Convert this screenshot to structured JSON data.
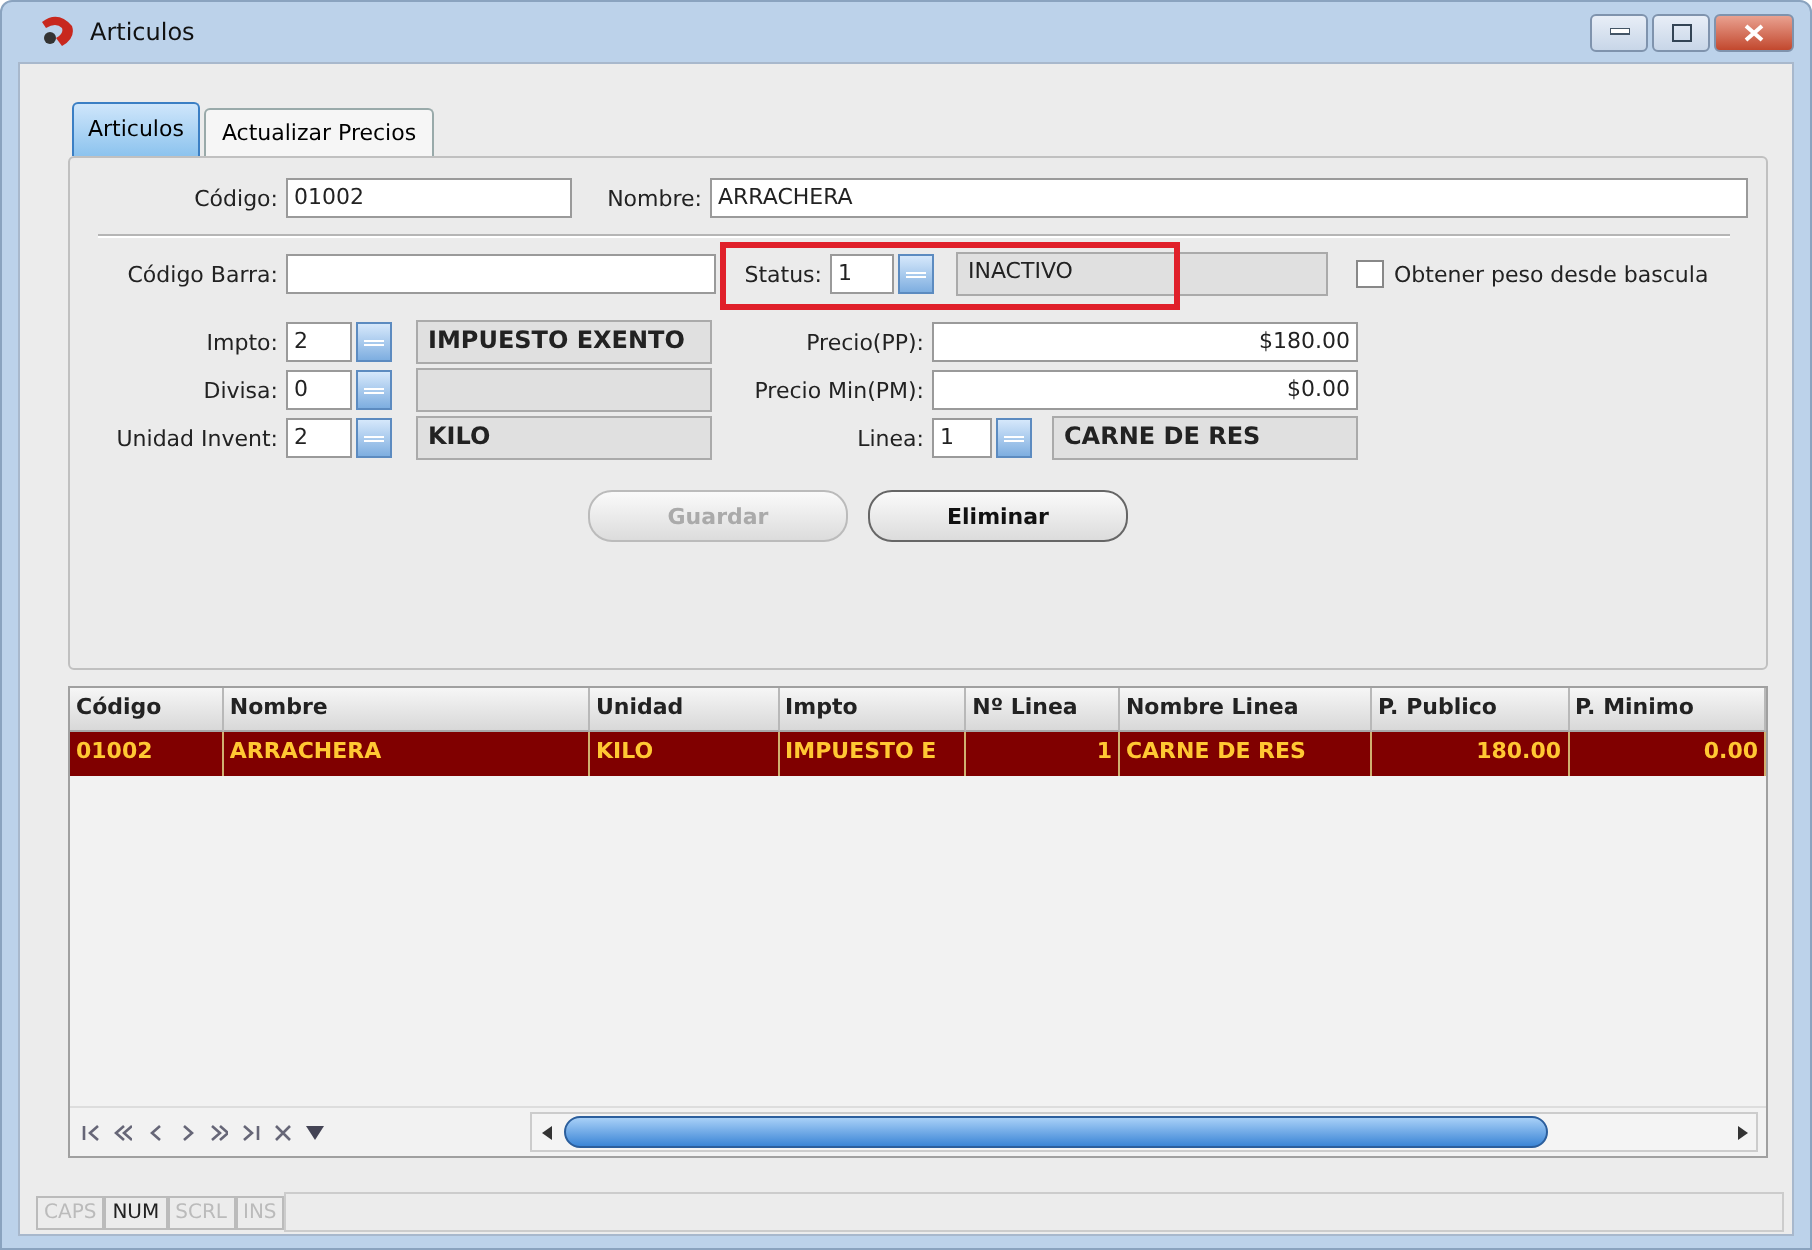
{
  "window": {
    "title": "Articulos"
  },
  "tabs": [
    {
      "label": "Articulos",
      "selected": true
    },
    {
      "label": "Actualizar Precios",
      "selected": false
    }
  ],
  "form": {
    "codigo": {
      "label": "Código:",
      "value": "01002"
    },
    "nombre": {
      "label": "Nombre:",
      "value": "ARRACHERA"
    },
    "codigo_barra": {
      "label": "Código Barra:"
    },
    "status": {
      "label": "Status:",
      "value": "1",
      "description": "INACTIVO",
      "highlighted": true
    },
    "obtener_peso": {
      "label": "Obtener peso desde bascula",
      "checked": false
    },
    "impto": {
      "label": "Impto:",
      "value": "2",
      "description": "IMPUESTO EXENTO"
    },
    "divisa": {
      "label": "Divisa:",
      "value": "0"
    },
    "unidad_invent": {
      "label": "Unidad Invent:",
      "value": "2",
      "description": "KILO"
    },
    "precio_pp": {
      "label": "Precio(PP):",
      "value": "$180.00"
    },
    "precio_min": {
      "label": "Precio Min(PM):",
      "value": "$0.00"
    },
    "linea": {
      "label": "Linea:",
      "value": "1",
      "description": "CARNE DE RES"
    }
  },
  "buttons": [
    {
      "label": "Guardar",
      "disabled": true
    },
    {
      "label": "Eliminar",
      "disabled": false
    }
  ],
  "table": {
    "columns": [
      "Código",
      "Nombre",
      "Unidad",
      "Impto",
      "Nº Linea",
      "Nombre Linea",
      "P. Publico",
      "P. Minimo"
    ],
    "rows": [
      {
        "selected": true,
        "cells": [
          "01002",
          "ARRACHERA",
          "KILO",
          "IMPUESTO E",
          "1",
          "CARNE DE RES",
          "180.00",
          "0.00"
        ]
      }
    ]
  },
  "status_bar": [
    {
      "label": "CAPS",
      "on": false
    },
    {
      "label": "NUM",
      "on": true
    },
    {
      "label": "SCRL",
      "on": false
    },
    {
      "label": "INS",
      "on": false
    }
  ]
}
